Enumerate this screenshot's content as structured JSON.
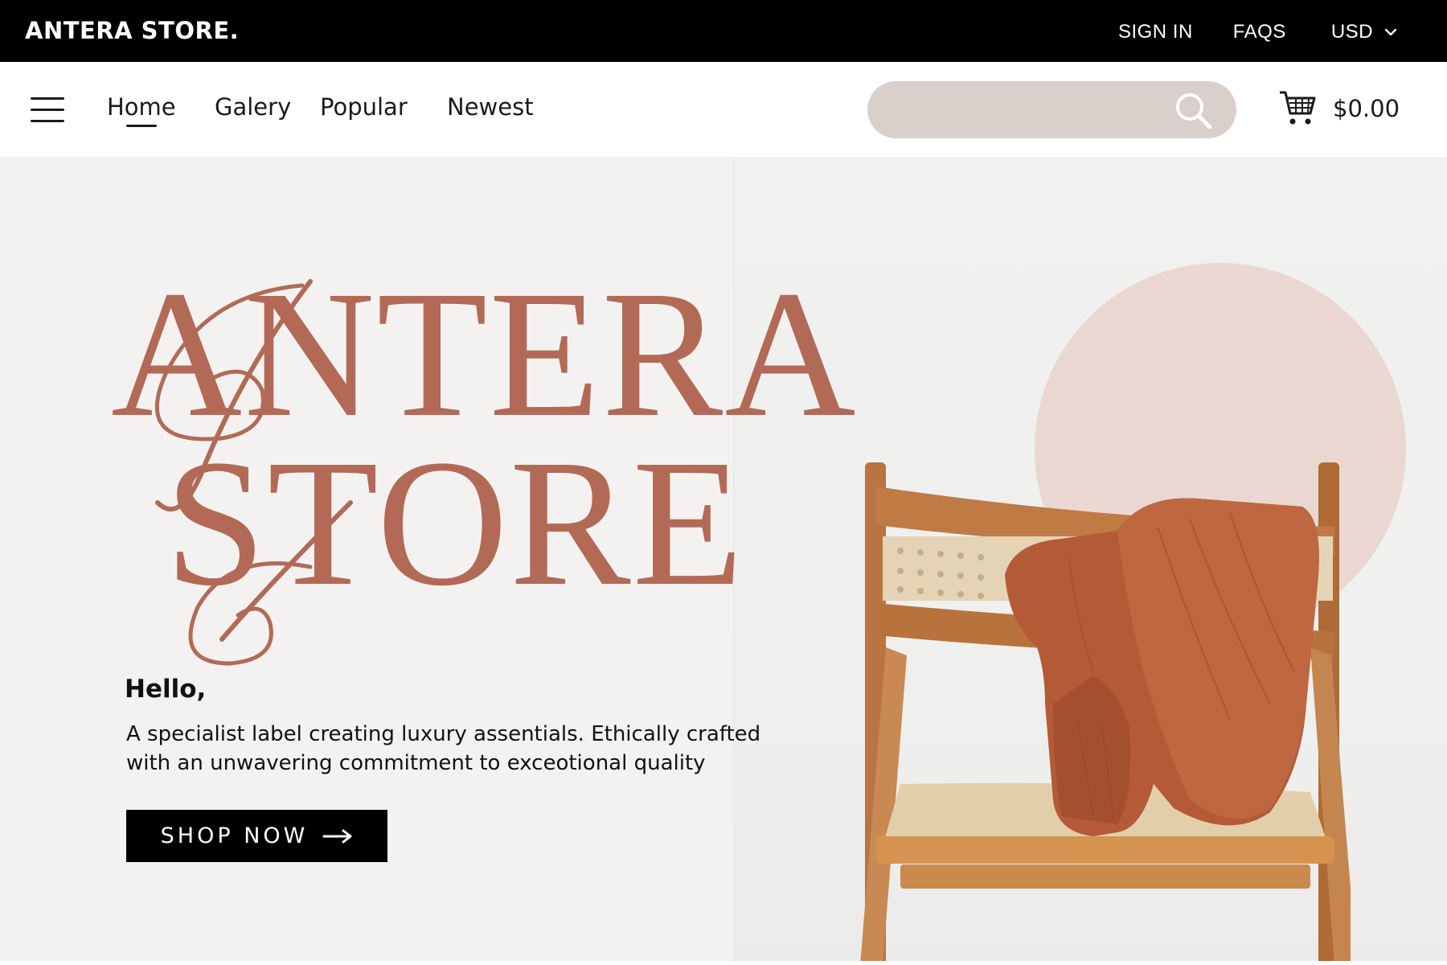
{
  "topbar": {
    "brand": "ANTERA STORE.",
    "sign_in": "SIGN IN",
    "faqs": "FAQS",
    "currency": "USD"
  },
  "nav": {
    "links": [
      "Home",
      "Galery",
      "Popular",
      "Newest"
    ],
    "active": "Home",
    "search_placeholder": "",
    "cart_total": "$0.00"
  },
  "hero": {
    "logo_line1": "ANTERA",
    "logo_line2": "STORE",
    "greeting": "Hello,",
    "tagline": "A specialist label creating luxury assentials. Ethically crafted with an unwavering commitment to exceotional quality",
    "cta": "SHOP NOW"
  },
  "colors": {
    "brand_rust": "#b26a57",
    "circle_pink": "#ead7d1",
    "search_bg": "#d9cfcb",
    "hero_bg": "#f3f2f0"
  },
  "icons": [
    "menu-icon",
    "search-icon",
    "cart-icon",
    "chevron-down-icon",
    "arrow-right-icon"
  ]
}
